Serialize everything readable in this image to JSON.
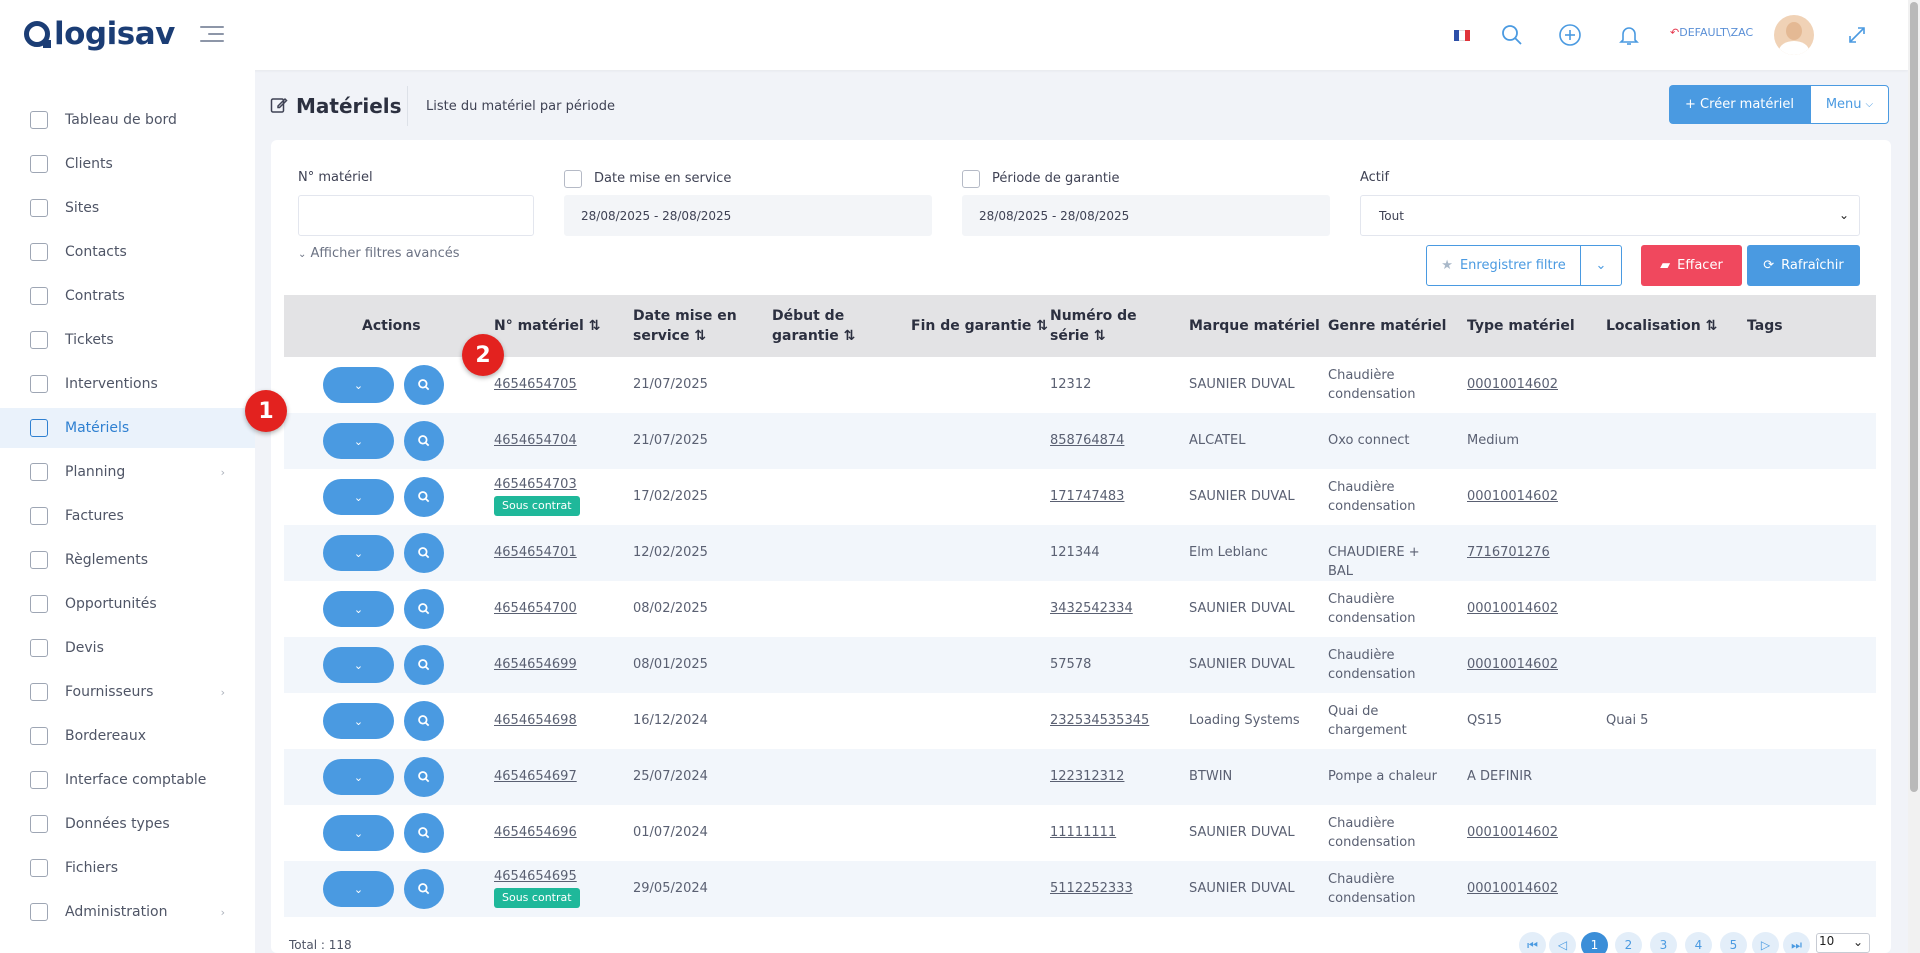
{
  "app": {
    "logo_text": "logisav",
    "user_label": "DEFAULT\\ZAC",
    "brand_color": "#1b3d75",
    "accent": "#4a9ae1"
  },
  "header": {
    "icons": [
      "fr-flag-icon",
      "search-icon",
      "plus-circle-icon",
      "bell-icon",
      "back-arrow-icon",
      "avatar",
      "expand-icon"
    ]
  },
  "sidebar": {
    "items": [
      {
        "label": "Tableau de bord",
        "icon": "dashboard-icon"
      },
      {
        "label": "Clients",
        "icon": "clients-icon"
      },
      {
        "label": "Sites",
        "icon": "sites-icon"
      },
      {
        "label": "Contacts",
        "icon": "contacts-icon"
      },
      {
        "label": "Contrats",
        "icon": "contracts-icon"
      },
      {
        "label": "Tickets",
        "icon": "tickets-icon"
      },
      {
        "label": "Interventions",
        "icon": "wrench-icon"
      },
      {
        "label": "Matériels",
        "icon": "box-icon",
        "active": true
      },
      {
        "label": "Planning",
        "icon": "calendar-icon",
        "has_submenu": true
      },
      {
        "label": "Factures",
        "icon": "invoice-icon"
      },
      {
        "label": "Règlements",
        "icon": "payment-icon"
      },
      {
        "label": "Opportunités",
        "icon": "opportunity-icon"
      },
      {
        "label": "Devis",
        "icon": "quote-icon"
      },
      {
        "label": "Fournisseurs",
        "icon": "supplier-icon",
        "has_submenu": true
      },
      {
        "label": "Bordereaux",
        "icon": "slip-icon"
      },
      {
        "label": "Interface comptable",
        "icon": "export-icon"
      },
      {
        "label": "Données types",
        "icon": "data-icon"
      },
      {
        "label": "Fichiers",
        "icon": "files-icon"
      },
      {
        "label": "Administration",
        "icon": "admin-icon",
        "has_submenu": true
      }
    ]
  },
  "page": {
    "title": "Matériels",
    "subtitle": "Liste du matériel par période",
    "create_label": "+ Créer matériel",
    "menu_label": "Menu"
  },
  "filters": {
    "num_label": "N° matériel",
    "num_value": "",
    "date_service_label": "Date mise en service",
    "date_service_value": "28/08/2025 - 28/08/2025",
    "garantie_label": "Période de garantie",
    "garantie_value": "28/08/2025 - 28/08/2025",
    "actif_label": "Actif",
    "actif_value": "Tout",
    "advanced_label": "Afficher filtres avancés",
    "save_label": "Enregistrer filtre",
    "clear_label": "Effacer",
    "refresh_label": "Rafraîchir"
  },
  "table": {
    "headers": {
      "actions": "Actions",
      "num": "N° matériel",
      "date_service": "Date mise en service",
      "debut_garantie": "Début de garantie",
      "fin_garantie": "Fin de garantie",
      "serie": "Numéro de série",
      "marque": "Marque matériel",
      "genre": "Genre matériel",
      "type": "Type matériel",
      "localisation": "Localisation",
      "tags": "Tags"
    },
    "sort_symbol": "⇅",
    "rows": [
      {
        "num": "4654654705",
        "badge": "",
        "date": "21/07/2025",
        "serie": "12312",
        "serie_link": false,
        "marque": "SAUNIER DUVAL",
        "genre": "Chaudière condensation",
        "type": "00010014602",
        "type_link": true,
        "loc": ""
      },
      {
        "num": "4654654704",
        "badge": "",
        "date": "21/07/2025",
        "serie": "858764874",
        "serie_link": true,
        "marque": "ALCATEL",
        "genre": "Oxo connect",
        "type": "Medium",
        "type_link": false,
        "loc": ""
      },
      {
        "num": "4654654703",
        "badge": "Sous contrat",
        "date": "17/02/2025",
        "serie": "171747483",
        "serie_link": true,
        "marque": "SAUNIER DUVAL",
        "genre": "Chaudière condensation",
        "type": "00010014602",
        "type_link": true,
        "loc": ""
      },
      {
        "num": "4654654701",
        "badge": "",
        "date": "12/02/2025",
        "serie": "121344",
        "serie_link": false,
        "marque": "Elm Leblanc",
        "genre": "CHAUDIERE + BAL",
        "type": "7716701276",
        "type_link": true,
        "loc": ""
      },
      {
        "num": "4654654700",
        "badge": "",
        "date": "08/02/2025",
        "serie": "3432542334",
        "serie_link": true,
        "marque": "SAUNIER DUVAL",
        "genre": "Chaudière condensation",
        "type": "00010014602",
        "type_link": true,
        "loc": ""
      },
      {
        "num": "4654654699",
        "badge": "",
        "date": "08/01/2025",
        "serie": "57578",
        "serie_link": false,
        "marque": "SAUNIER DUVAL",
        "genre": "Chaudière condensation",
        "type": "00010014602",
        "type_link": true,
        "loc": ""
      },
      {
        "num": "4654654698",
        "badge": "",
        "date": "16/12/2024",
        "serie": "232534535345",
        "serie_link": true,
        "marque": "Loading Systems",
        "genre": "Quai de chargement",
        "type": "QS15",
        "type_link": false,
        "loc": "Quai 5"
      },
      {
        "num": "4654654697",
        "badge": "",
        "date": "25/07/2024",
        "serie": "122312312",
        "serie_link": true,
        "marque": "BTWIN",
        "genre": "Pompe a chaleur",
        "type": "A DEFINIR",
        "type_link": false,
        "loc": ""
      },
      {
        "num": "4654654696",
        "badge": "",
        "date": "01/07/2024",
        "serie": "11111111",
        "serie_link": true,
        "marque": "SAUNIER DUVAL",
        "genre": "Chaudière condensation",
        "type": "00010014602",
        "type_link": true,
        "loc": ""
      },
      {
        "num": "4654654695",
        "badge": "Sous contrat",
        "date": "29/05/2024",
        "serie": "5112252333",
        "serie_link": true,
        "marque": "SAUNIER DUVAL",
        "genre": "Chaudière condensation",
        "type": "00010014602",
        "type_link": true,
        "loc": ""
      }
    ]
  },
  "footer": {
    "total": "Total : 118",
    "pages": [
      "1",
      "2",
      "3",
      "4",
      "5"
    ],
    "current_page": "1",
    "page_size": "10"
  },
  "annotations": [
    "1",
    "2"
  ]
}
